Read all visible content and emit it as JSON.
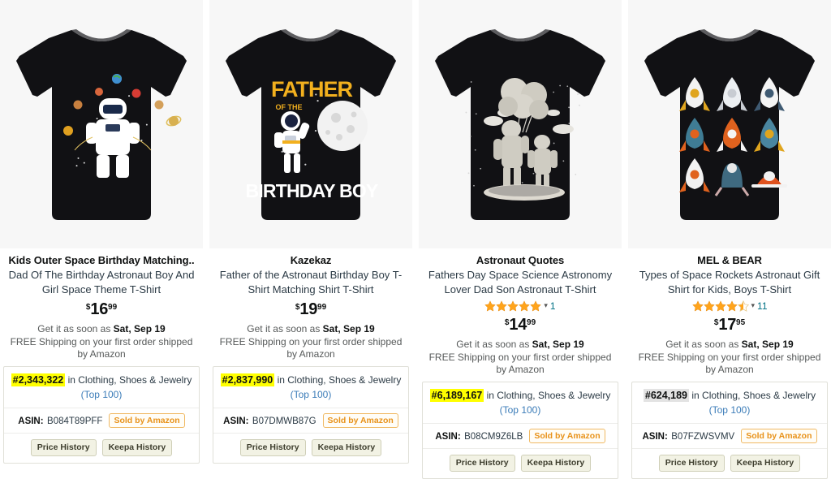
{
  "page": {
    "context": "amazon-search-results-with-keepa-overlay",
    "accent_link_color": "#007185",
    "rank_highlight_color": "#ffff00",
    "rank_highlight_alt_color": "#e3e3e3",
    "sold_by_color": "#e8921a"
  },
  "labels": {
    "rank_suffix": "in Clothing, Shoes & Jewelry",
    "top_100": "(Top 100)",
    "asin_label": "ASIN:",
    "sold_by": "Sold by Amazon",
    "price_history": "Price History",
    "keepa_history": "Keepa History",
    "delivery_prefix": "Get it as soon as",
    "free_shipping": "FREE Shipping on your first order shipped by Amazon",
    "currency_symbol": "$"
  },
  "products": [
    {
      "brand": "Kids Outer Space Birthday Matching..",
      "subtitle": "Dad Of The Birthday Astronaut Boy And Girl Space Theme T-Shirt",
      "has_rating": false,
      "rating_stars": 0,
      "rating_count": "",
      "price_whole": "16",
      "price_frac": "99",
      "delivery_date": "Sat, Sep 19",
      "rank": "#2,343,322",
      "rank_highlight": "yellow",
      "asin": "B084T89PFF",
      "image": {
        "name": "astronaut-juggling-planets-tshirt",
        "shirt_color": "#111114",
        "design": "astronaut juggling planets on black tee"
      }
    },
    {
      "brand": "Kazekaz",
      "subtitle": "Father of the Astronaut Birthday Boy T-Shirt Matching Shirt T-Shirt",
      "has_rating": false,
      "rating_stars": 0,
      "rating_count": "",
      "price_whole": "19",
      "price_frac": "99",
      "delivery_date": "Sat, Sep 19",
      "rank": "#2,837,990",
      "rank_highlight": "yellow",
      "asin": "B07DMWB87G",
      "image": {
        "name": "father-of-the-birthday-boy-tshirt",
        "shirt_color": "#111114",
        "design": "FATHER OF THE BIRTHDAY BOY with astronaut and moon"
      }
    },
    {
      "brand": "Astronaut Quotes",
      "subtitle": "Fathers Day Space Science Astronomy Lover Dad Son Astronaut T-Shirt",
      "has_rating": true,
      "rating_stars": 5,
      "rating_count": "1",
      "price_whole": "14",
      "price_frac": "99",
      "delivery_date": "Sat, Sep 19",
      "rank": "#6,189,167",
      "rank_highlight": "yellow",
      "asin": "B08CM9Z6LB",
      "image": {
        "name": "dad-and-son-astronauts-balloons-tshirt",
        "shirt_color": "#111114",
        "design": "dad and son astronauts holding moon balloons"
      }
    },
    {
      "brand": "MEL & BEAR",
      "subtitle": "Types of Space Rockets Astronaut Gift Shirt for Kids, Boys T-Shirt",
      "has_rating": true,
      "rating_stars": 4.5,
      "rating_count": "11",
      "price_whole": "17",
      "price_frac": "95",
      "delivery_date": "Sat, Sep 19",
      "rank": "#624,189",
      "rank_highlight": "gray",
      "asin": "B07FZWSVMV",
      "image": {
        "name": "types-of-space-rockets-tshirt",
        "shirt_color": "#111114",
        "design": "3x3 grid of colorful rockets"
      }
    }
  ]
}
